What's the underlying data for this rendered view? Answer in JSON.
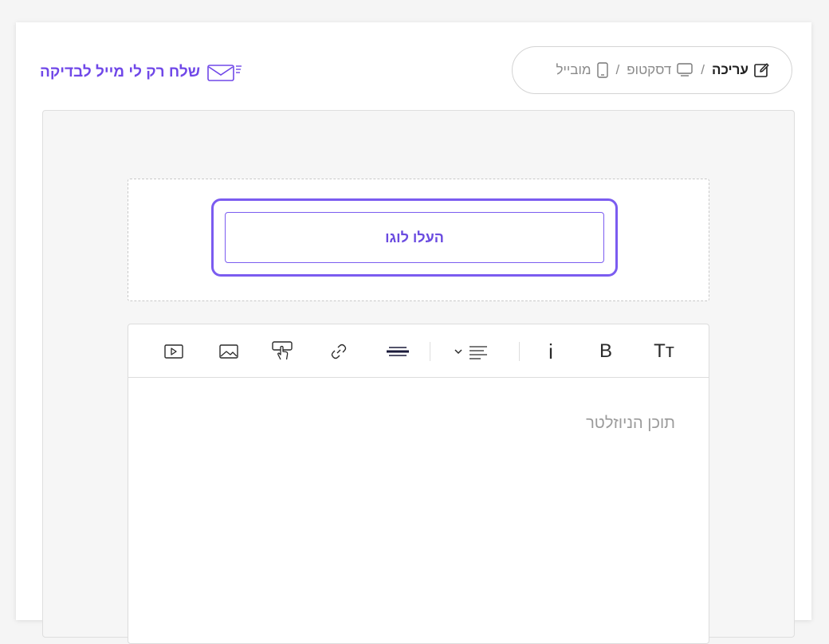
{
  "header": {
    "modes": [
      {
        "label": "עריכה",
        "icon": "edit-icon",
        "active": true
      },
      {
        "label": "דסקטופ",
        "icon": "desktop-icon",
        "active": false
      },
      {
        "label": "מובייל",
        "icon": "mobile-icon",
        "active": false
      }
    ],
    "separator": "/",
    "test_mail_label": "שלח רק לי מייל לבדיקה",
    "test_mail_icon": "envelope-icon"
  },
  "logo_zone": {
    "upload_label": "העלו לוגו"
  },
  "editor": {
    "toolbar": [
      {
        "name": "video-icon"
      },
      {
        "name": "image-icon"
      },
      {
        "name": "button-click-icon"
      },
      {
        "name": "link-icon"
      },
      {
        "name": "divider-icon"
      },
      {
        "name": "align-dropdown-icon"
      },
      {
        "name": "italic-icon",
        "glyph": "i"
      },
      {
        "name": "bold-icon",
        "glyph": "B"
      },
      {
        "name": "text-size-icon",
        "glyph": "Tт"
      }
    ],
    "placeholder": "תוכן הניוזלטר"
  },
  "colors": {
    "accent": "#7b5cf0",
    "accent_text": "#6a4be0",
    "muted": "#8a8a8a"
  }
}
